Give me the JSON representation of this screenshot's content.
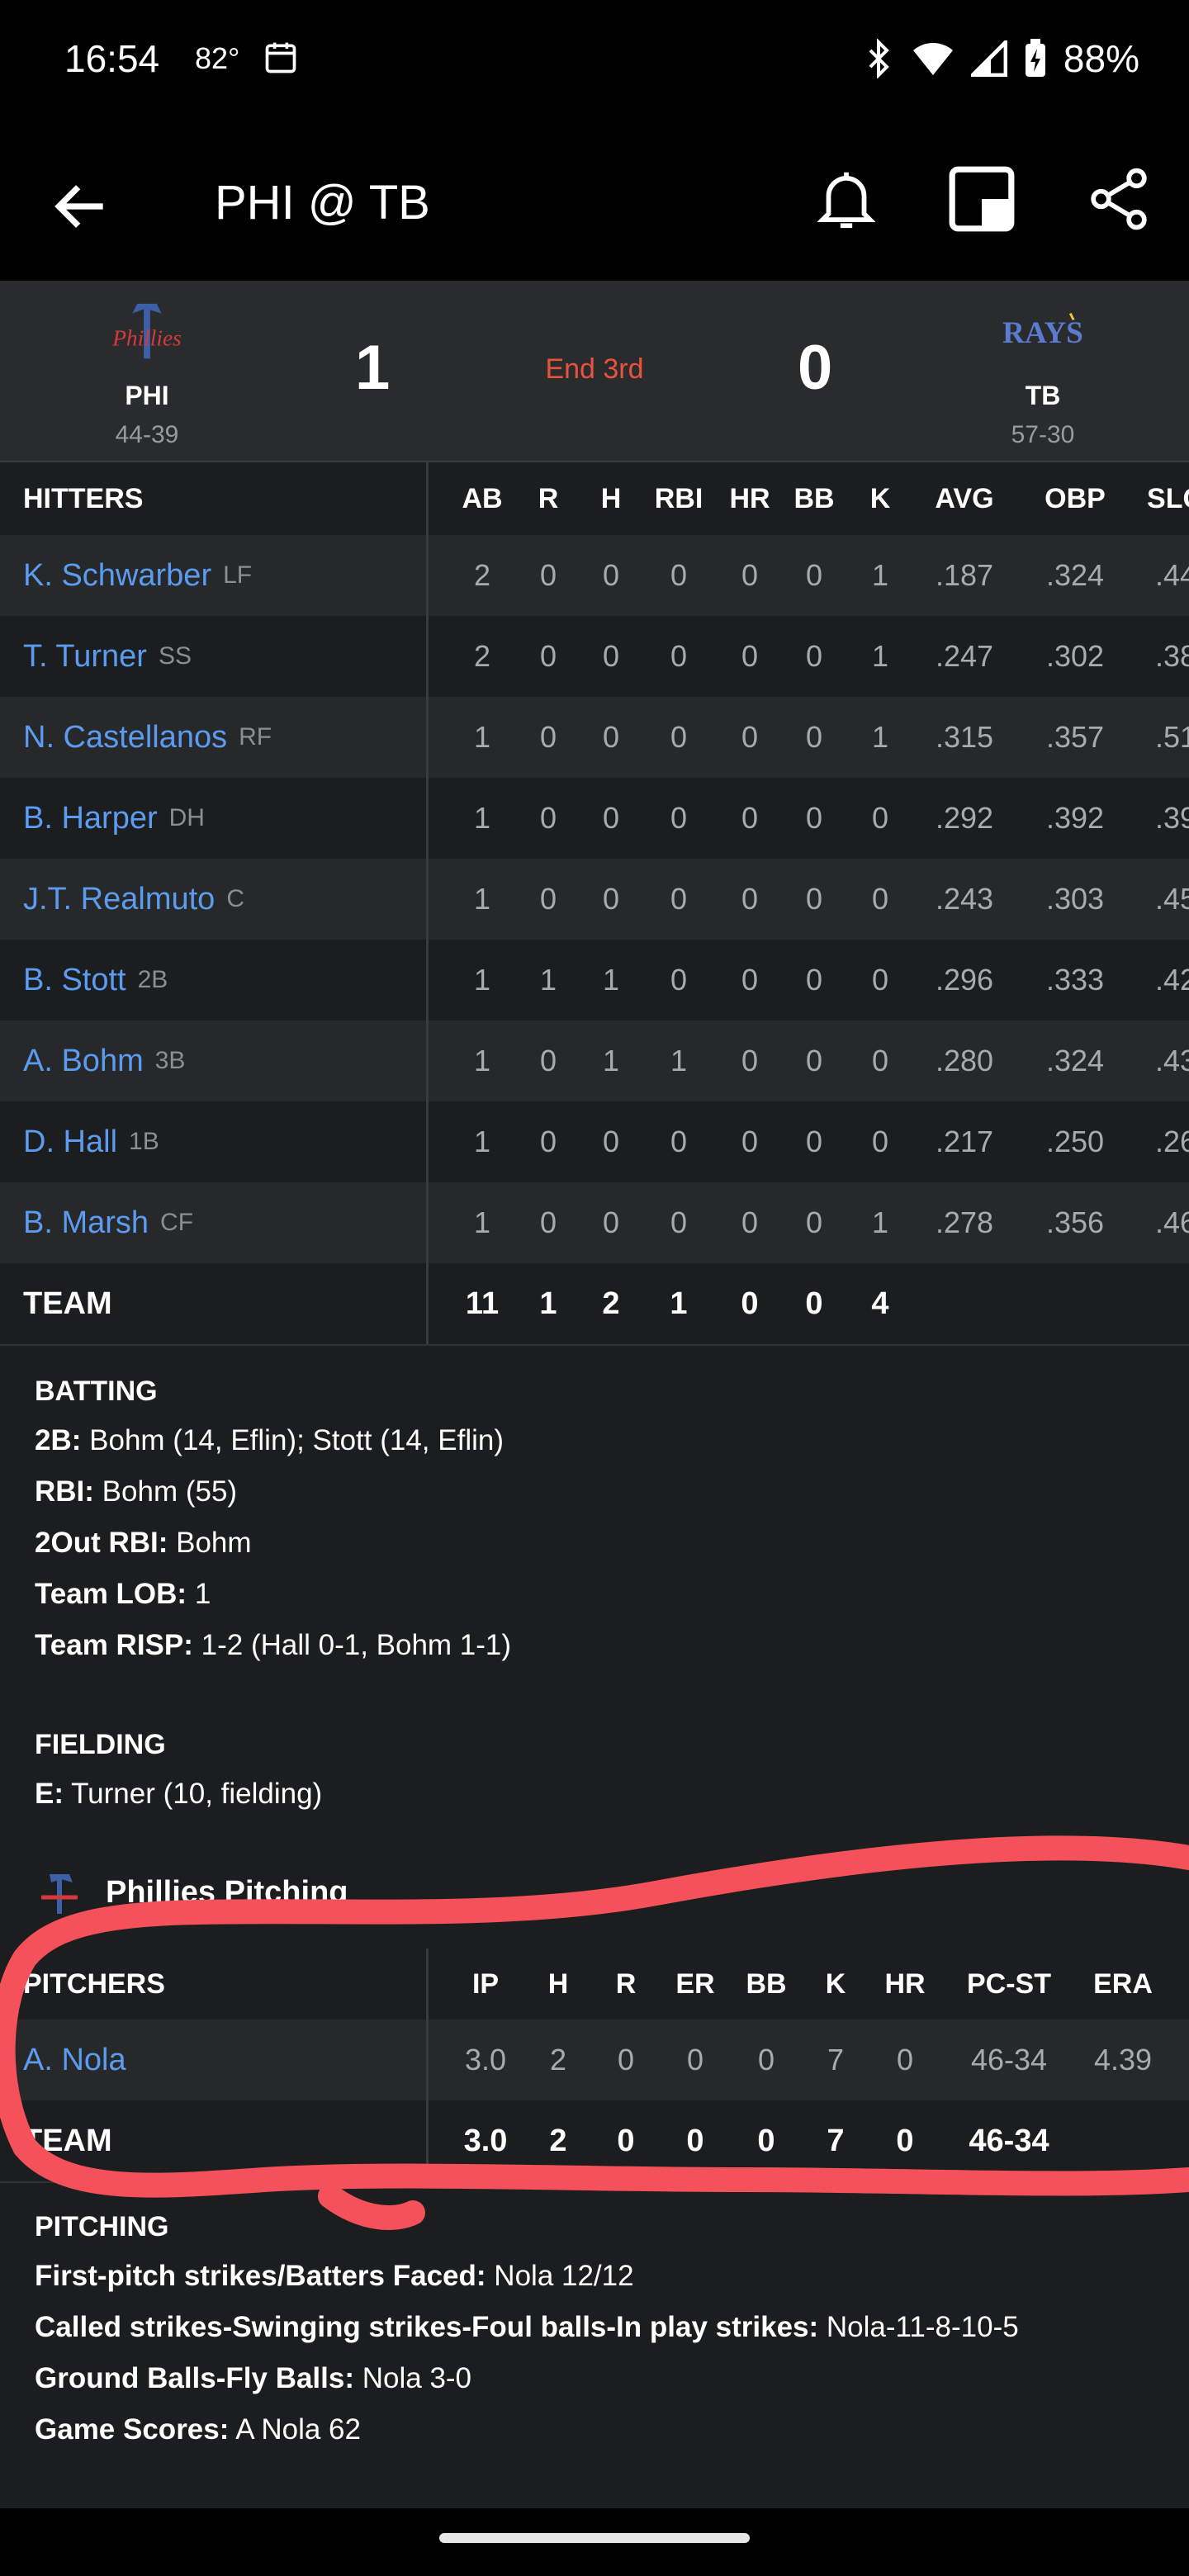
{
  "status": {
    "time": "16:54",
    "temp": "82°",
    "battery": "88%"
  },
  "appbar": {
    "title": "PHI @ TB"
  },
  "game": {
    "away": {
      "abbr": "PHI",
      "record": "44-39",
      "score": "1",
      "logo_text": "Phillies"
    },
    "home": {
      "abbr": "TB",
      "record": "57-30",
      "score": "0",
      "logo_text": "RAYS"
    },
    "inning": "End 3rd"
  },
  "hitters": {
    "header": "HITTERS",
    "columns": [
      "AB",
      "R",
      "H",
      "RBI",
      "HR",
      "BB",
      "K",
      "AVG",
      "OBP",
      "SLG"
    ],
    "rows": [
      {
        "name": "K. Schwarber",
        "pos": "LF",
        "stats": [
          "2",
          "0",
          "0",
          "0",
          "0",
          "0",
          "1",
          ".187",
          ".324",
          ".44"
        ]
      },
      {
        "name": "T. Turner",
        "pos": "SS",
        "stats": [
          "2",
          "0",
          "0",
          "0",
          "0",
          "0",
          "1",
          ".247",
          ".302",
          ".38"
        ]
      },
      {
        "name": "N. Castellanos",
        "pos": "RF",
        "stats": [
          "1",
          "0",
          "0",
          "0",
          "0",
          "0",
          "1",
          ".315",
          ".357",
          ".51"
        ]
      },
      {
        "name": "B. Harper",
        "pos": "DH",
        "stats": [
          "1",
          "0",
          "0",
          "0",
          "0",
          "0",
          "0",
          ".292",
          ".392",
          ".39"
        ]
      },
      {
        "name": "J.T. Realmuto",
        "pos": "C",
        "stats": [
          "1",
          "0",
          "0",
          "0",
          "0",
          "0",
          "0",
          ".243",
          ".303",
          ".45"
        ]
      },
      {
        "name": "B. Stott",
        "pos": "2B",
        "stats": [
          "1",
          "1",
          "1",
          "0",
          "0",
          "0",
          "0",
          ".296",
          ".333",
          ".42"
        ]
      },
      {
        "name": "A. Bohm",
        "pos": "3B",
        "stats": [
          "1",
          "0",
          "1",
          "1",
          "0",
          "0",
          "0",
          ".280",
          ".324",
          ".43"
        ]
      },
      {
        "name": "D. Hall",
        "pos": "1B",
        "stats": [
          "1",
          "0",
          "0",
          "0",
          "0",
          "0",
          "0",
          ".217",
          ".250",
          ".26"
        ]
      },
      {
        "name": "B. Marsh",
        "pos": "CF",
        "stats": [
          "1",
          "0",
          "0",
          "0",
          "0",
          "0",
          "1",
          ".278",
          ".356",
          ".46"
        ]
      }
    ],
    "team": {
      "label": "TEAM",
      "stats": [
        "11",
        "1",
        "2",
        "1",
        "0",
        "0",
        "4"
      ]
    }
  },
  "batting": {
    "title": "BATTING",
    "lines": [
      {
        "k": "2B:",
        "v": "Bohm (14, Eflin); Stott (14, Eflin)"
      },
      {
        "k": "RBI:",
        "v": "Bohm (55)"
      },
      {
        "k": "2Out RBI:",
        "v": "Bohm"
      },
      {
        "k": "Team LOB:",
        "v": "1"
      },
      {
        "k": "Team RISP:",
        "v": "1-2 (Hall 0-1, Bohm 1-1)"
      }
    ]
  },
  "fielding": {
    "title": "FIELDING",
    "lines": [
      {
        "k": "E:",
        "v": "Turner (10, fielding)"
      }
    ]
  },
  "pitching_section": {
    "title": "Phillies Pitching"
  },
  "pitchers": {
    "header": "PITCHERS",
    "columns": [
      "IP",
      "H",
      "R",
      "ER",
      "BB",
      "K",
      "HR",
      "PC-ST",
      "ERA"
    ],
    "rows": [
      {
        "name": "A. Nola",
        "stats": [
          "3.0",
          "2",
          "0",
          "0",
          "0",
          "7",
          "0",
          "46-34",
          "4.39"
        ]
      }
    ],
    "team": {
      "label": "TEAM",
      "stats": [
        "3.0",
        "2",
        "0",
        "0",
        "0",
        "7",
        "0",
        "46-34"
      ]
    }
  },
  "pitching": {
    "title": "PITCHING",
    "lines": [
      {
        "k": "First-pitch strikes/Batters Faced:",
        "v": "Nola 12/12"
      },
      {
        "k": "Called strikes-Swinging strikes-Foul balls-In play strikes:",
        "v": "Nola-11-8-10-5"
      },
      {
        "k": "Ground Balls-Fly Balls:",
        "v": "Nola 3-0"
      },
      {
        "k": "Game Scores:",
        "v": "A Nola 62"
      }
    ]
  },
  "colors": {
    "link": "#5b9bf0",
    "inning": "#e8533f",
    "annotation": "#f4515a"
  }
}
